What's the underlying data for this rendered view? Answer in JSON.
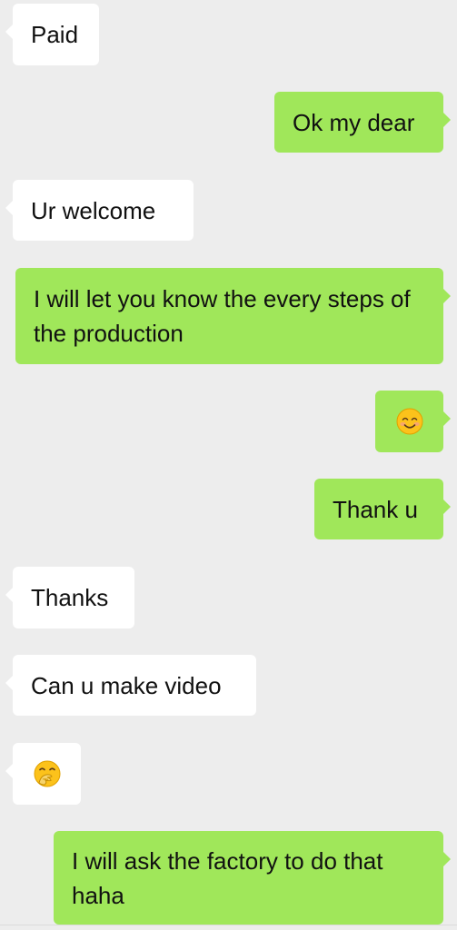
{
  "messages": [
    {
      "side": "in",
      "text": "Paid"
    },
    {
      "side": "out",
      "text": "Ok my dear"
    },
    {
      "side": "in",
      "text": "Ur welcome"
    },
    {
      "side": "out",
      "text": "I will let you know the every steps of the production"
    },
    {
      "side": "out",
      "emoji": "smiling-face-emoji"
    },
    {
      "side": "out",
      "text": "Thank u"
    },
    {
      "side": "in",
      "text": "Thanks"
    },
    {
      "side": "in",
      "text": "Can u make video"
    },
    {
      "side": "in",
      "emoji": "hand-over-mouth-emoji"
    },
    {
      "side": "out",
      "text": "I will ask the factory to do that haha"
    }
  ],
  "colors": {
    "background": "#ededed",
    "incoming_bubble": "#ffffff",
    "outgoing_bubble": "#a0e75a"
  }
}
